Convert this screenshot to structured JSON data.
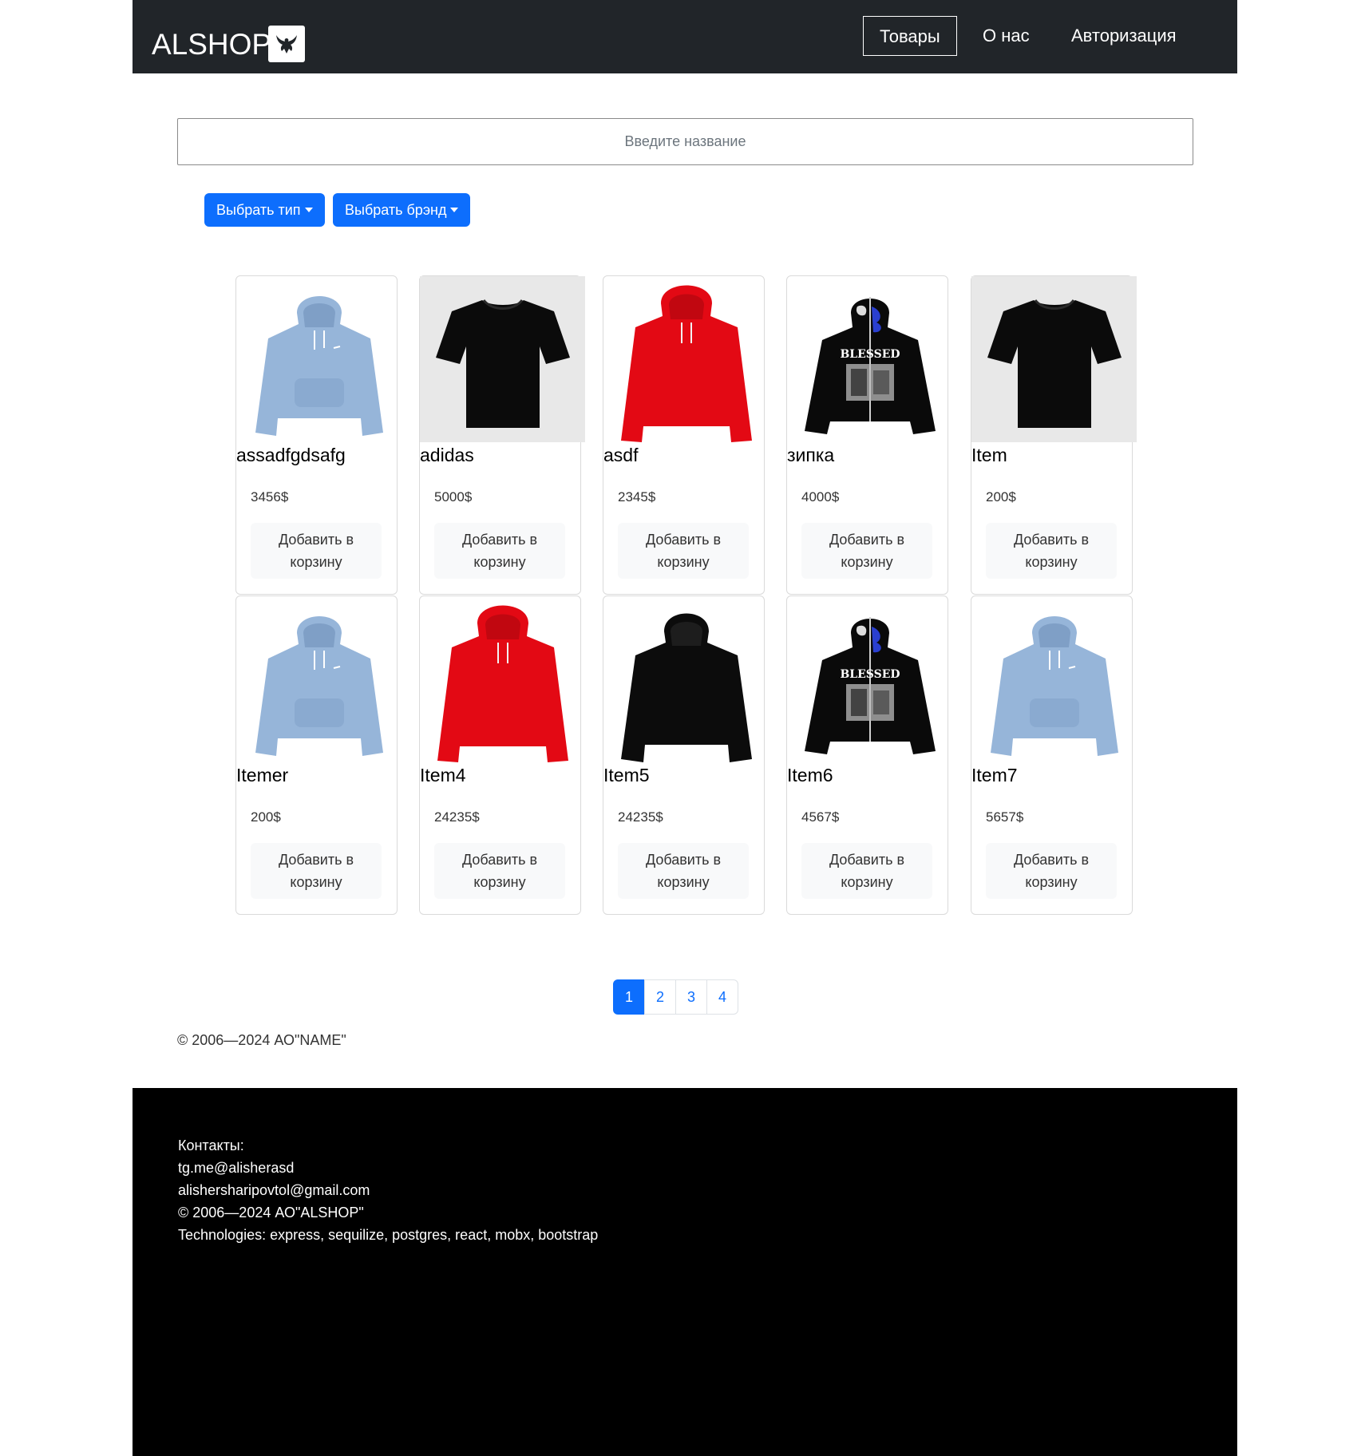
{
  "colors": {
    "navbar_bg": "#212529",
    "primary": "#0d6efd",
    "footer_bg": "#000000"
  },
  "navbar": {
    "brand": "ALSHOP",
    "logo_icon": "eagle-logo-icon",
    "links": [
      "Товары",
      "О нас",
      "Авторизация"
    ],
    "active": "Товары"
  },
  "search": {
    "placeholder": "Введите название",
    "value": ""
  },
  "filters": {
    "type_label": "Выбрать тип",
    "brand_label": "Выбрать брэнд"
  },
  "products": [
    {
      "name": "assadfgdsafg",
      "price": "3456$",
      "button": "Добавить в корзину",
      "image": "blue-hoodie"
    },
    {
      "name": "adidas",
      "price": "5000$",
      "button": "Добавить в корзину",
      "image": "black-tshirt"
    },
    {
      "name": "asdf",
      "price": "2345$",
      "button": "Добавить в корзину",
      "image": "red-hoodie"
    },
    {
      "name": "зипка",
      "price": "4000$",
      "button": "Добавить в корзину",
      "image": "black-zip-hoodie"
    },
    {
      "name": "Item",
      "price": "200$",
      "button": "Добавить в корзину",
      "image": "black-tshirt"
    },
    {
      "name": "Itemer",
      "price": "200$",
      "button": "Добавить в корзину",
      "image": "blue-hoodie"
    },
    {
      "name": "Item4",
      "price": "24235$",
      "button": "Добавить в корзину",
      "image": "red-hoodie"
    },
    {
      "name": "Item5",
      "price": "24235$",
      "button": "Добавить в корзину",
      "image": "black-hoodie"
    },
    {
      "name": "Item6",
      "price": "4567$",
      "button": "Добавить в корзину",
      "image": "black-zip-hoodie"
    },
    {
      "name": "Item7",
      "price": "5657$",
      "button": "Добавить в корзину",
      "image": "blue-hoodie"
    }
  ],
  "pagination": {
    "pages": [
      "1",
      "2",
      "3",
      "4"
    ],
    "current": "1"
  },
  "copyright": "© 2006—2024 АО\"NAME\"",
  "footer": {
    "contacts_label": "Контакты:",
    "telegram": "tg.me@alisherasd",
    "email": "alishersharipovtol@gmail.com",
    "copyright": "© 2006—2024 АО\"ALSHOP\"",
    "technologies": "Technologies: express, sequilize, postgres, react, mobx, bootstrap"
  }
}
